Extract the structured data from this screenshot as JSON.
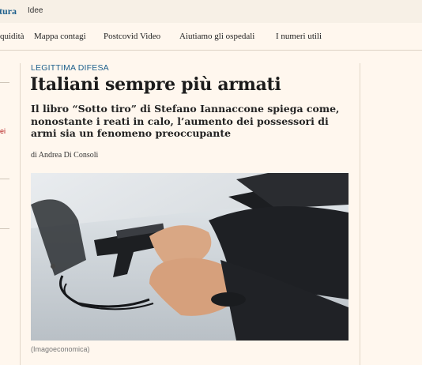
{
  "topbar": {
    "brand": "tura",
    "section": "Idee"
  },
  "nav": {
    "items": [
      "quidità",
      "Mappa contagi",
      "Postcovid Video",
      "Aiutiamo gli ospedali",
      "I numeri utili"
    ]
  },
  "sidebar": {
    "fragment": "ei"
  },
  "article": {
    "kicker": "LEGITTIMA DIFESA",
    "title": "Italiani sempre più armati",
    "summary": "Il libro “Sotto tiro” di Stefano Iannaccone spiega come, nonostante i reati in calo, l’aumento dei possessori di armi sia un fenomeno preoccupante",
    "byline": "di Andrea Di Consoli",
    "image_caption": "(Imagoeconomica)"
  },
  "colors": {
    "brand": "#1d5f8c",
    "kicker": "#1d5f8c",
    "background": "#fff7ee"
  }
}
